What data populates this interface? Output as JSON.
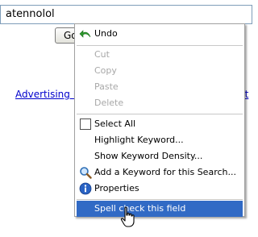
{
  "search": {
    "value": "atennolol"
  },
  "buttons": {
    "go_label": "Go"
  },
  "links": {
    "left_label": "Advertising P",
    "right_label": "ut"
  },
  "context_menu": {
    "undo": "Undo",
    "cut": "Cut",
    "copy": "Copy",
    "paste": "Paste",
    "delete": "Delete",
    "select_all": "Select All",
    "highlight_keyword": "Highlight Keyword...",
    "show_keyword_density": "Show Keyword Density...",
    "add_keyword": "Add a Keyword for this Search...",
    "properties": "Properties",
    "spell_check": "Spell check this field",
    "highlight_color": "#316ac5"
  }
}
